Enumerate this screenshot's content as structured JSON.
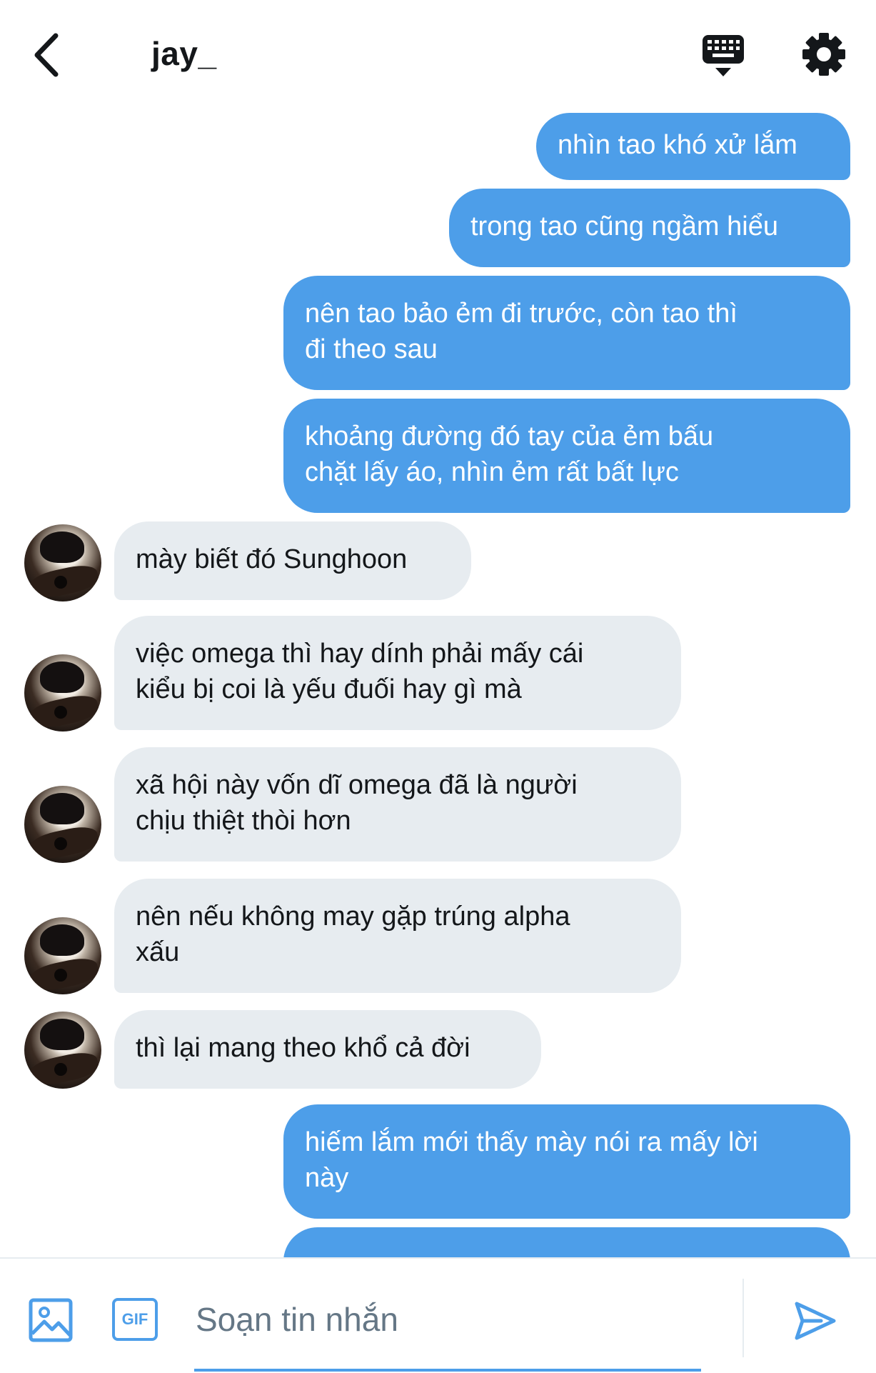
{
  "header": {
    "title": "jay_"
  },
  "messages": [
    {
      "dir": "sent",
      "text": "nhìn tao khó xử lắm"
    },
    {
      "dir": "sent",
      "text": "trong tao cũng ngầm hiểu"
    },
    {
      "dir": "sent",
      "text": "nên tao bảo ẻm đi trước, còn tao thì\nđi theo sau"
    },
    {
      "dir": "sent",
      "text": "khoảng đường đó tay của ẻm bấu\nchặt lấy áo, nhìn ẻm rất bất lực"
    },
    {
      "dir": "recv",
      "text": "mày biết đó Sunghoon"
    },
    {
      "dir": "recv",
      "text": "việc omega thì hay dính phải mấy cái\nkiểu bị coi là yếu đuối hay gì mà"
    },
    {
      "dir": "recv",
      "text": "xã hội này vốn dĩ omega đã là người\nchịu thiệt thòi hơn"
    },
    {
      "dir": "recv",
      "text": "nên nếu không may gặp trúng alpha\nxấu"
    },
    {
      "dir": "recv",
      "text": "thì lại mang theo khổ cả đời"
    },
    {
      "dir": "sent",
      "text": "hiếm lắm mới thấy mày nói ra mấy lời\nnày"
    },
    {
      "dir": "sent",
      "text": ""
    }
  ],
  "composer": {
    "placeholder": "Soạn tin nhắn",
    "value": "",
    "gif_label": "GIF"
  },
  "icons": {
    "back": "chevron-left-icon",
    "keyboard": "keyboard-icon",
    "settings": "gear-icon",
    "image": "image-icon",
    "gif": "gif-icon",
    "send": "send-icon"
  },
  "colors": {
    "accent": "#4d9ee9",
    "received_bubble": "#e7ecf0",
    "text": "#14171a",
    "placeholder": "#657786"
  }
}
